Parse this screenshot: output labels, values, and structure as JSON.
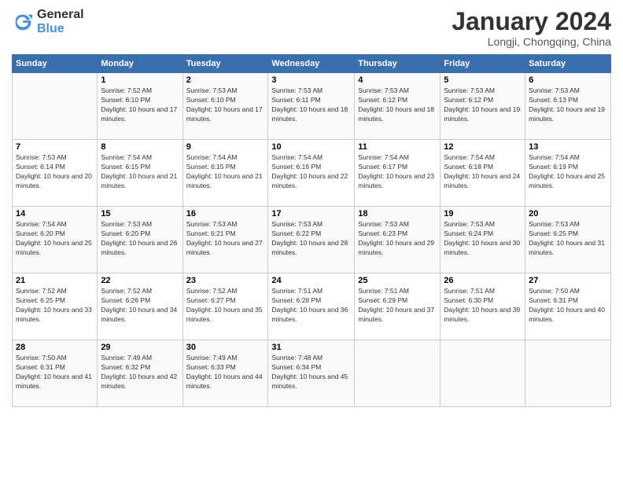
{
  "header": {
    "logo_line1": "General",
    "logo_line2": "Blue",
    "month_year": "January 2024",
    "location": "Longji, Chongqing, China"
  },
  "weekdays": [
    "Sunday",
    "Monday",
    "Tuesday",
    "Wednesday",
    "Thursday",
    "Friday",
    "Saturday"
  ],
  "weeks": [
    [
      {
        "day": "",
        "sunrise": "",
        "sunset": "",
        "daylight": ""
      },
      {
        "day": "1",
        "sunrise": "Sunrise: 7:52 AM",
        "sunset": "Sunset: 6:10 PM",
        "daylight": "Daylight: 10 hours and 17 minutes."
      },
      {
        "day": "2",
        "sunrise": "Sunrise: 7:53 AM",
        "sunset": "Sunset: 6:10 PM",
        "daylight": "Daylight: 10 hours and 17 minutes."
      },
      {
        "day": "3",
        "sunrise": "Sunrise: 7:53 AM",
        "sunset": "Sunset: 6:11 PM",
        "daylight": "Daylight: 10 hours and 18 minutes."
      },
      {
        "day": "4",
        "sunrise": "Sunrise: 7:53 AM",
        "sunset": "Sunset: 6:12 PM",
        "daylight": "Daylight: 10 hours and 18 minutes."
      },
      {
        "day": "5",
        "sunrise": "Sunrise: 7:53 AM",
        "sunset": "Sunset: 6:12 PM",
        "daylight": "Daylight: 10 hours and 19 minutes."
      },
      {
        "day": "6",
        "sunrise": "Sunrise: 7:53 AM",
        "sunset": "Sunset: 6:13 PM",
        "daylight": "Daylight: 10 hours and 19 minutes."
      }
    ],
    [
      {
        "day": "7",
        "sunrise": "Sunrise: 7:53 AM",
        "sunset": "Sunset: 6:14 PM",
        "daylight": "Daylight: 10 hours and 20 minutes."
      },
      {
        "day": "8",
        "sunrise": "Sunrise: 7:54 AM",
        "sunset": "Sunset: 6:15 PM",
        "daylight": "Daylight: 10 hours and 21 minutes."
      },
      {
        "day": "9",
        "sunrise": "Sunrise: 7:54 AM",
        "sunset": "Sunset: 6:15 PM",
        "daylight": "Daylight: 10 hours and 21 minutes."
      },
      {
        "day": "10",
        "sunrise": "Sunrise: 7:54 AM",
        "sunset": "Sunset: 6:16 PM",
        "daylight": "Daylight: 10 hours and 22 minutes."
      },
      {
        "day": "11",
        "sunrise": "Sunrise: 7:54 AM",
        "sunset": "Sunset: 6:17 PM",
        "daylight": "Daylight: 10 hours and 23 minutes."
      },
      {
        "day": "12",
        "sunrise": "Sunrise: 7:54 AM",
        "sunset": "Sunset: 6:18 PM",
        "daylight": "Daylight: 10 hours and 24 minutes."
      },
      {
        "day": "13",
        "sunrise": "Sunrise: 7:54 AM",
        "sunset": "Sunset: 6:19 PM",
        "daylight": "Daylight: 10 hours and 25 minutes."
      }
    ],
    [
      {
        "day": "14",
        "sunrise": "Sunrise: 7:54 AM",
        "sunset": "Sunset: 6:20 PM",
        "daylight": "Daylight: 10 hours and 25 minutes."
      },
      {
        "day": "15",
        "sunrise": "Sunrise: 7:53 AM",
        "sunset": "Sunset: 6:20 PM",
        "daylight": "Daylight: 10 hours and 26 minutes."
      },
      {
        "day": "16",
        "sunrise": "Sunrise: 7:53 AM",
        "sunset": "Sunset: 6:21 PM",
        "daylight": "Daylight: 10 hours and 27 minutes."
      },
      {
        "day": "17",
        "sunrise": "Sunrise: 7:53 AM",
        "sunset": "Sunset: 6:22 PM",
        "daylight": "Daylight: 10 hours and 28 minutes."
      },
      {
        "day": "18",
        "sunrise": "Sunrise: 7:53 AM",
        "sunset": "Sunset: 6:23 PM",
        "daylight": "Daylight: 10 hours and 29 minutes."
      },
      {
        "day": "19",
        "sunrise": "Sunrise: 7:53 AM",
        "sunset": "Sunset: 6:24 PM",
        "daylight": "Daylight: 10 hours and 30 minutes."
      },
      {
        "day": "20",
        "sunrise": "Sunrise: 7:53 AM",
        "sunset": "Sunset: 6:25 PM",
        "daylight": "Daylight: 10 hours and 31 minutes."
      }
    ],
    [
      {
        "day": "21",
        "sunrise": "Sunrise: 7:52 AM",
        "sunset": "Sunset: 6:25 PM",
        "daylight": "Daylight: 10 hours and 33 minutes."
      },
      {
        "day": "22",
        "sunrise": "Sunrise: 7:52 AM",
        "sunset": "Sunset: 6:26 PM",
        "daylight": "Daylight: 10 hours and 34 minutes."
      },
      {
        "day": "23",
        "sunrise": "Sunrise: 7:52 AM",
        "sunset": "Sunset: 6:27 PM",
        "daylight": "Daylight: 10 hours and 35 minutes."
      },
      {
        "day": "24",
        "sunrise": "Sunrise: 7:51 AM",
        "sunset": "Sunset: 6:28 PM",
        "daylight": "Daylight: 10 hours and 36 minutes."
      },
      {
        "day": "25",
        "sunrise": "Sunrise: 7:51 AM",
        "sunset": "Sunset: 6:29 PM",
        "daylight": "Daylight: 10 hours and 37 minutes."
      },
      {
        "day": "26",
        "sunrise": "Sunrise: 7:51 AM",
        "sunset": "Sunset: 6:30 PM",
        "daylight": "Daylight: 10 hours and 39 minutes."
      },
      {
        "day": "27",
        "sunrise": "Sunrise: 7:50 AM",
        "sunset": "Sunset: 6:31 PM",
        "daylight": "Daylight: 10 hours and 40 minutes."
      }
    ],
    [
      {
        "day": "28",
        "sunrise": "Sunrise: 7:50 AM",
        "sunset": "Sunset: 6:31 PM",
        "daylight": "Daylight: 10 hours and 41 minutes."
      },
      {
        "day": "29",
        "sunrise": "Sunrise: 7:49 AM",
        "sunset": "Sunset: 6:32 PM",
        "daylight": "Daylight: 10 hours and 42 minutes."
      },
      {
        "day": "30",
        "sunrise": "Sunrise: 7:49 AM",
        "sunset": "Sunset: 6:33 PM",
        "daylight": "Daylight: 10 hours and 44 minutes."
      },
      {
        "day": "31",
        "sunrise": "Sunrise: 7:48 AM",
        "sunset": "Sunset: 6:34 PM",
        "daylight": "Daylight: 10 hours and 45 minutes."
      },
      {
        "day": "",
        "sunrise": "",
        "sunset": "",
        "daylight": ""
      },
      {
        "day": "",
        "sunrise": "",
        "sunset": "",
        "daylight": ""
      },
      {
        "day": "",
        "sunrise": "",
        "sunset": "",
        "daylight": ""
      }
    ]
  ]
}
